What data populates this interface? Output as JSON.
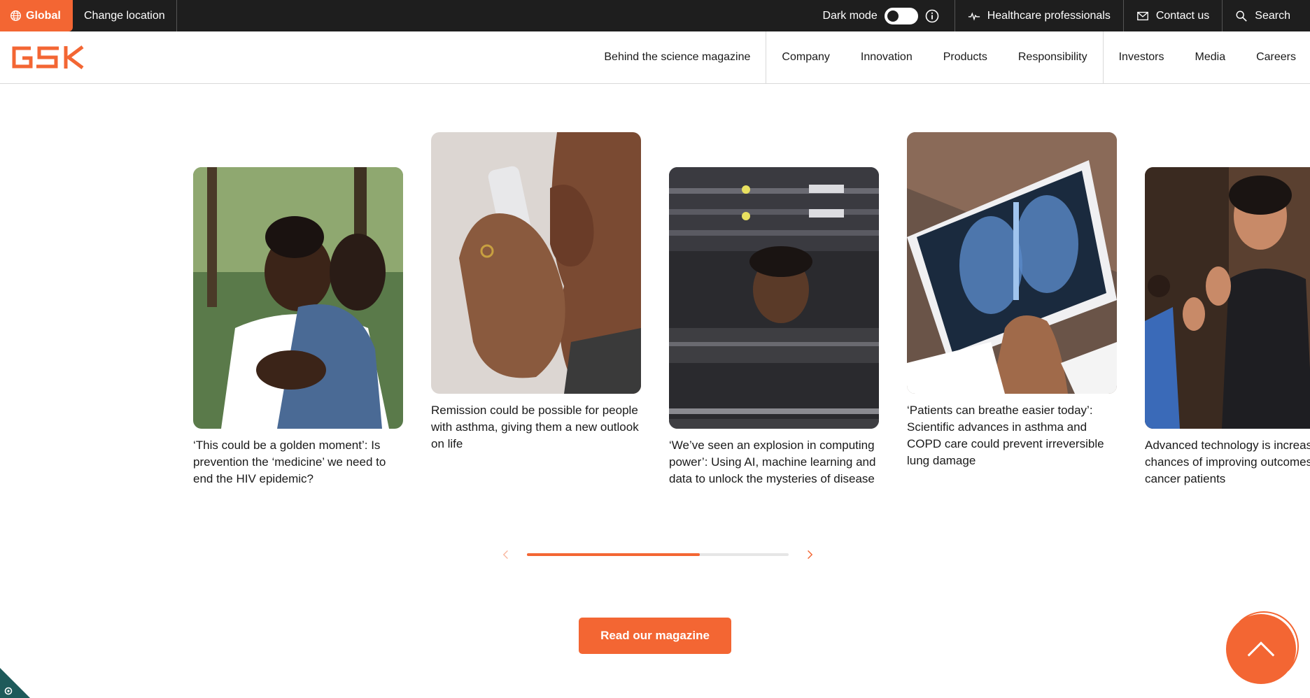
{
  "topbar": {
    "global_label": "Global",
    "change_location": "Change location",
    "dark_mode_label": "Dark mode",
    "healthcare": "Healthcare professionals",
    "contact": "Contact us",
    "search": "Search"
  },
  "brand": {
    "logo_text": "GSK",
    "accent": "#f36633",
    "topbar_bg": "#1e1e1e"
  },
  "nav": {
    "items": [
      "Behind the science magazine",
      "Company",
      "Innovation",
      "Products",
      "Responsibility",
      "Investors",
      "Media",
      "Careers"
    ]
  },
  "carousel": {
    "cards": [
      {
        "caption": "‘This could be a golden moment’: Is prevention the ‘medicine’ we need to end the HIV epidemic?",
        "image": "two-women-embracing-photo"
      },
      {
        "caption": "Remission could be possible for people with asthma, giving them a new outlook on life",
        "image": "woman-using-inhaler-photo"
      },
      {
        "caption": "‘We’ve seen an explosion in computing power’: Using AI, machine learning and data to unlock the mysteries of disease",
        "image": "man-in-server-room-photo"
      },
      {
        "caption": "‘Patients can breathe easier today’: Scientific advances in asthma and COPD care could prevent irreversible lung damage",
        "image": "chest-xray-tablet-photo"
      },
      {
        "caption": "Advanced technology is increasing the chances of improving outcomes for cancer patients",
        "image": "man-gesturing-photo"
      }
    ],
    "progress": 0.66
  },
  "cta": {
    "label": "Read our magazine"
  }
}
